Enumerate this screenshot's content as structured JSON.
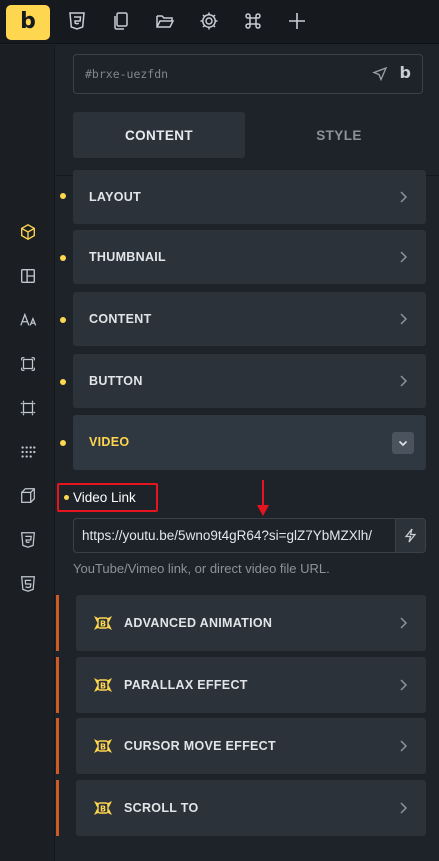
{
  "brand": {
    "logo_letter": "b",
    "accent": "#ffd64f"
  },
  "topbar": {
    "icons": [
      "css3-icon",
      "copy-icon",
      "folder-open-icon",
      "settings-gear-icon",
      "command-key-icon",
      "plus-icon"
    ]
  },
  "leftbar": {
    "icons": [
      "cube-icon",
      "layout-panels-icon",
      "typography-icon",
      "spacing-box-icon",
      "sizing-frame-icon",
      "grid-dots-icon",
      "3d-box-icon",
      "css3-icon",
      "html5-icon"
    ],
    "active": "cube-icon"
  },
  "element_id": {
    "value": "#brxe-uezfdn"
  },
  "tabs": {
    "content": "CONTENT",
    "style": "STYLE"
  },
  "sections": [
    {
      "label": "LAYOUT"
    },
    {
      "label": "THUMBNAIL"
    },
    {
      "label": "CONTENT"
    },
    {
      "label": "BUTTON"
    },
    {
      "label": "VIDEO",
      "expanded": true
    }
  ],
  "video_link": {
    "label": "Video Link",
    "value": "https://youtu.be/5wno9t4gR64?si=glZ7YbMZXlh/",
    "hint": "YouTube/Vimeo link, or direct video file URL.",
    "highlight_color": "#e5151f"
  },
  "extensions": [
    {
      "label": "ADVANCED ANIMATION"
    },
    {
      "label": "PARALLAX EFFECT"
    },
    {
      "label": "CURSOR MOVE EFFECT"
    },
    {
      "label": "SCROLL TO"
    }
  ],
  "extension_accent": "#cf5a25"
}
